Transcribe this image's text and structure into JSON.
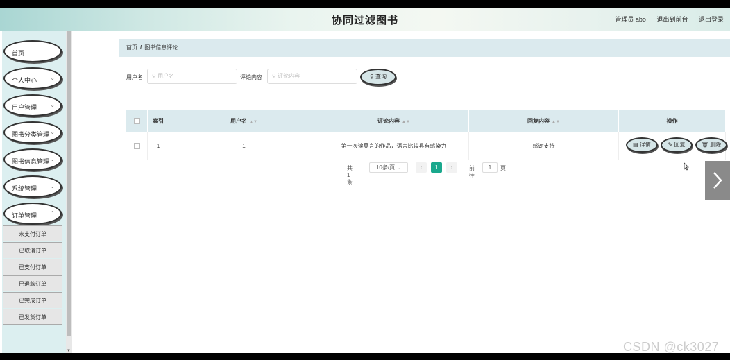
{
  "header": {
    "title": "协同过滤图书",
    "admin": "管理员 abo",
    "back_to_front": "退出到前台",
    "logout": "退出登录"
  },
  "sidebar": {
    "menu": [
      {
        "label": "首页",
        "has_chevron": false
      },
      {
        "label": "个人中心",
        "has_chevron": true
      },
      {
        "label": "用户管理",
        "has_chevron": true
      },
      {
        "label": "图书分类管理",
        "has_chevron": true
      },
      {
        "label": "图书信息管理",
        "has_chevron": true
      },
      {
        "label": "系统管理",
        "has_chevron": true
      },
      {
        "label": "订单管理",
        "has_chevron": true
      }
    ],
    "submenu": [
      "未支付订单",
      "已取消订单",
      "已支付订单",
      "已退款订单",
      "已完成订单",
      "已发货订单"
    ]
  },
  "breadcrumb": {
    "home": "首页",
    "separator": "/",
    "current": "图书信息评论"
  },
  "search": {
    "username_label": "用户名",
    "username_placeholder": "用户名",
    "comment_label": "评论内容",
    "comment_placeholder": "评论内容",
    "query_button": "查询"
  },
  "table": {
    "headers": [
      "索引",
      "用户名",
      "评论内容",
      "回复内容",
      "操作"
    ],
    "rows": [
      {
        "index": "1",
        "username": "1",
        "comment": "第一次读莫言的作品，语言比较具有感染力",
        "reply": "感谢支持"
      }
    ],
    "actions": {
      "detail": "详情",
      "reply": "回复",
      "delete": "删除"
    }
  },
  "pagination": {
    "total": "共 1 条",
    "page_size": "10条/页",
    "current_page": "1",
    "goto_label": "前往",
    "goto_value": "1",
    "page_unit": "页"
  },
  "watermark": "CSDN @ck3027",
  "colors": {
    "accent": "#1aa88d",
    "header_bg": "#dbeaee"
  }
}
